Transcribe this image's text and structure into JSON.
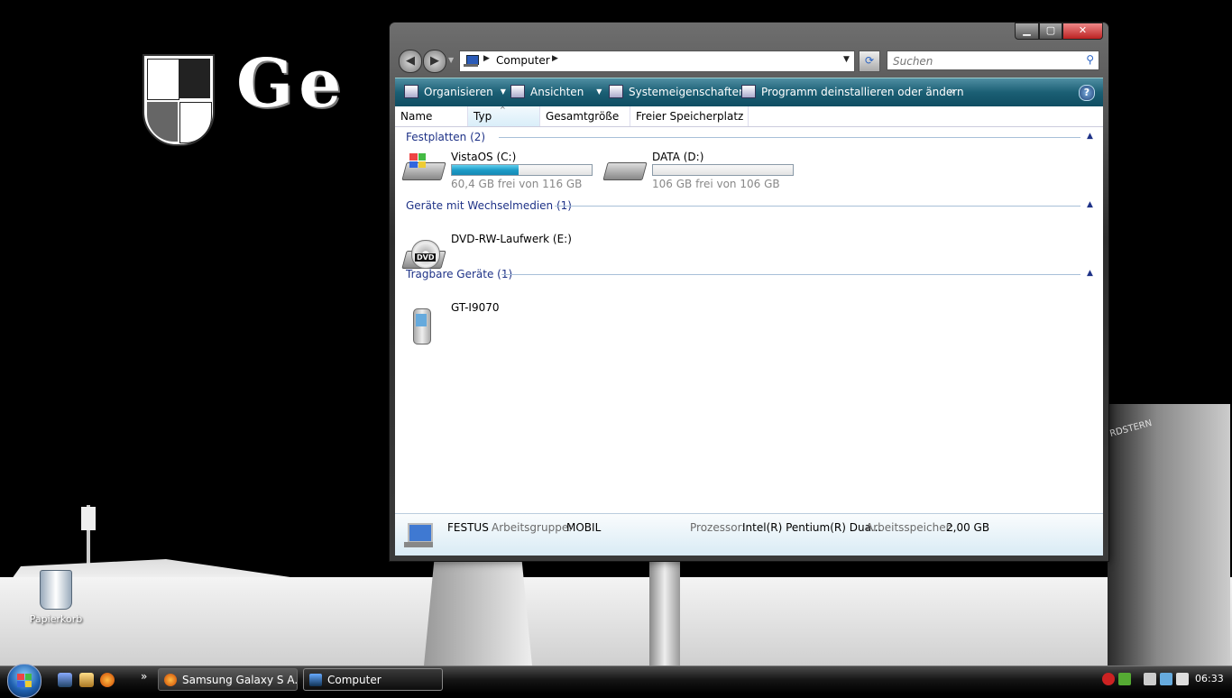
{
  "window": {
    "address": {
      "crumb": "Computer"
    },
    "search": {
      "placeholder": "Suchen"
    },
    "toolbar": {
      "organize": "Organisieren",
      "views": "Ansichten",
      "system_properties": "Systemeigenschaften",
      "uninstall": "Programm deinstallieren oder ändern",
      "more": "»"
    },
    "columns": [
      "Name",
      "Typ",
      "Gesamtgröße",
      "Freier Speicherplatz"
    ],
    "groups": {
      "hard_disks": {
        "title": "Festplatten (2)",
        "items": [
          {
            "name": "VistaOS (C:)",
            "free_text": "60,4 GB frei von 116 GB",
            "used_fraction": 0.48
          },
          {
            "name": "DATA (D:)",
            "free_text": "106 GB frei von 106 GB",
            "used_fraction": 0.0
          }
        ]
      },
      "removable": {
        "title": "Geräte mit Wechselmedien (1)",
        "items": [
          {
            "name": "DVD-RW-Laufwerk (E:)"
          }
        ]
      },
      "portable": {
        "title": "Tragbare Geräte (1)",
        "items": [
          {
            "name": "GT-I9070"
          }
        ]
      }
    },
    "details": {
      "computer_name": "FESTUS",
      "workgroup_label": "Arbeitsgruppe:",
      "workgroup_value": "MOBIL",
      "processor_label": "Prozessor:",
      "processor_value": "Intel(R) Pentium(R) Dua...",
      "memory_label": "Arbeitsspeicher:",
      "memory_value": "2,00 GB"
    }
  },
  "desktop": {
    "recycle_bin_label": "Papierkorb",
    "wallpaper_text": "Ge",
    "tower_sign": "RDSTERN"
  },
  "taskbar": {
    "quicklaunch_more": "»",
    "tasks": [
      {
        "label": "Samsung Galaxy S A..."
      },
      {
        "label": "Computer"
      }
    ],
    "clock": "06:33"
  },
  "colors": {
    "toolbar": "#1b5f74",
    "group_header": "#1e3287",
    "progress_fill": "#1e9cc8"
  }
}
